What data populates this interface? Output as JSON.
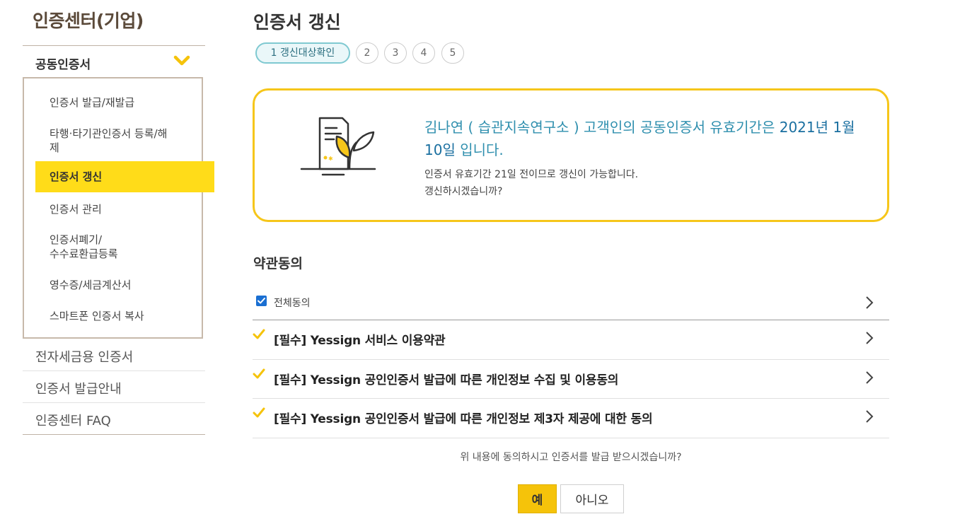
{
  "sidebar": {
    "title": "인증센터(기업)",
    "section": "공동인증서",
    "menu": [
      "인증서 발급/재발급",
      "타행·타기관인증서 등록/해\n제",
      "인증서 갱신",
      "인증서 관리",
      "인증서폐기/\n수수료환급등록",
      "영수증/세금계산서",
      "스마트폰 인증서 복사"
    ],
    "others": [
      "전자세금용 인증서",
      "인증서 발급안내",
      "인증센터 FAQ"
    ]
  },
  "main": {
    "title": "인증서 갱신",
    "steps": [
      "1 갱신대상확인",
      "2",
      "3",
      "4",
      "5"
    ],
    "info": {
      "name": "김나연 ( 습관지속연구소 )",
      "message_mid": "고객인의 공동인증서 유효기간은",
      "date": "2021년 1월 10일",
      "message_end": "입니다.",
      "sub_line1": "인증서 유효기간 21일 전이므로 갱신이 가능합니다.",
      "sub_line2": "갱신하시겠습니까?"
    },
    "terms_title": "약관동의",
    "agree_all": "전체동의",
    "terms": [
      "[필수] Yessign 서비스 이용약관",
      "[필수] Yessign 공인인증서 발급에 따른 개인정보 수집 및 이용동의",
      "[필수] Yessign 공인인증서 발급에 따른 개인정보 제3자 제공에 대한 동의"
    ],
    "question": "위 내용에 동의하시고 인증서를 발급 받으시겠습니까?",
    "yes_label": "예",
    "no_label": "아니오"
  },
  "colors": {
    "accent_yellow": "#ffdc19",
    "box_border": "#f6c61a",
    "step_teal": "#7fc9d1",
    "info_blue": "#2f8fae"
  }
}
